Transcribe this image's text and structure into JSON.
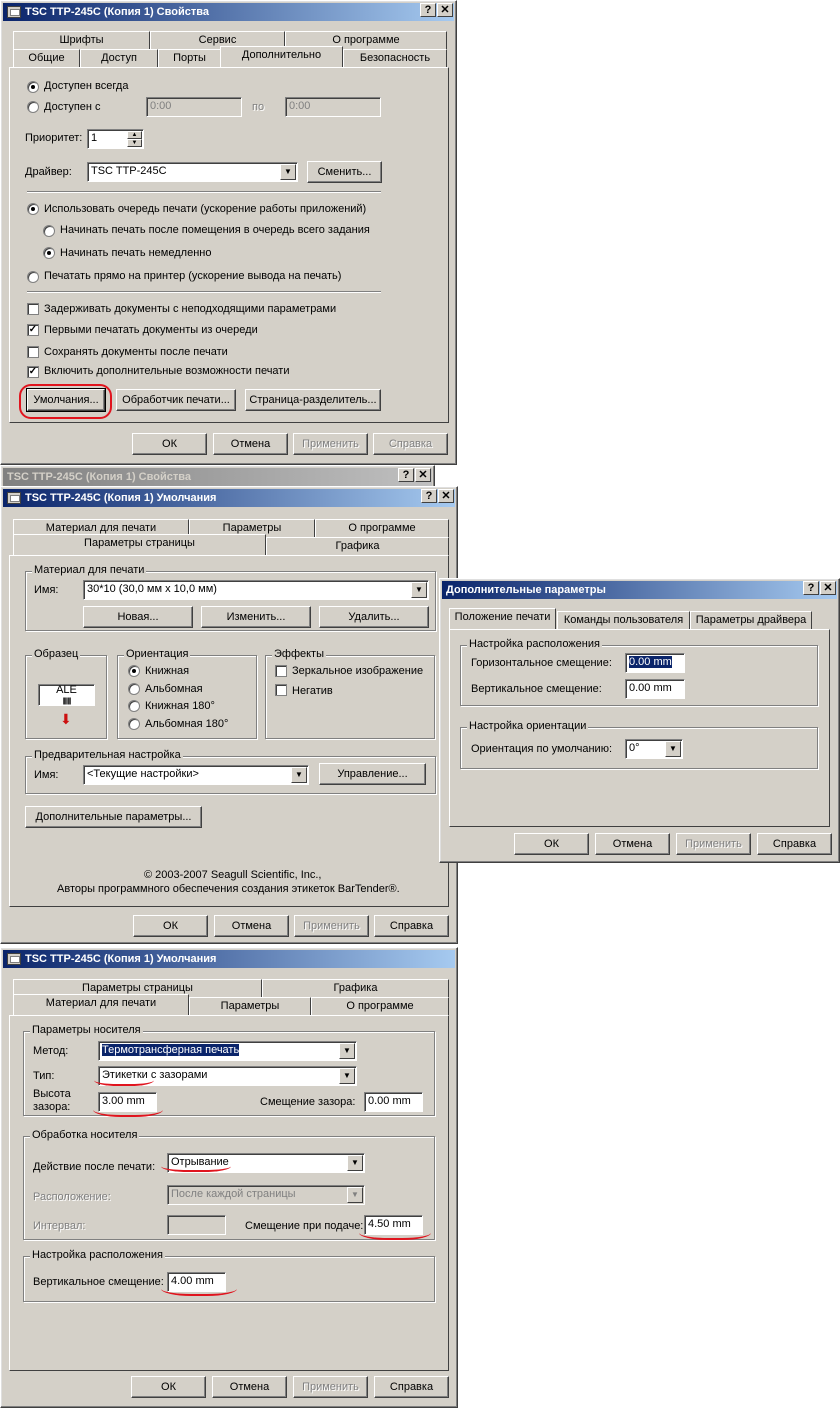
{
  "win1": {
    "title": "TSC TTP-245C (Копия 1) Свойства",
    "tabs_row1": [
      "Шрифты",
      "Сервис",
      "О программе"
    ],
    "tabs_row2": [
      "Общие",
      "Доступ",
      "Порты",
      "Дополнительно",
      "Безопасность"
    ],
    "always": "Доступен всегда",
    "from": "Доступен с",
    "time_from": "0:00",
    "to": "по",
    "time_to": "0:00",
    "priority_label": "Приоритет:",
    "priority_value": "1",
    "driver_label": "Драйвер:",
    "driver_value": "TSC TTP-245C",
    "change_btn": "Сменить...",
    "spool": "Использовать очередь печати (ускорение работы приложений)",
    "spool_after": "Начинать печать после помещения в очередь всего задания",
    "spool_immediate": "Начинать печать немедленно",
    "direct": "Печатать прямо на принтер (ускорение вывода на печать)",
    "chk_hold": "Задерживать документы с неподходящими параметрами",
    "chk_first": "Первыми печатать документы из очереди",
    "chk_keep": "Сохранять документы после печати",
    "chk_adv": "Включить дополнительные возможности печати",
    "defaults_btn": "Умолчания...",
    "processor_btn": "Обработчик печати...",
    "separator_btn": "Страница-разделитель...",
    "ok": "ОК",
    "cancel": "Отмена",
    "apply": "Применить",
    "help": "Справка"
  },
  "win2_bg_title": "TSC TTP-245C (Копия 1) Свойства",
  "win2": {
    "title": "TSC TTP-245C (Копия 1) Умолчания",
    "tabs_row1": [
      "Материал для печати",
      "Параметры",
      "О программе"
    ],
    "tabs_row2": [
      "Параметры страницы",
      "Графика"
    ],
    "media_group": "Материал для печати",
    "name_label": "Имя:",
    "name_value": "30*10 (30,0 мм x 10,0 мм)",
    "new_btn": "Новая...",
    "edit_btn": "Изменить...",
    "delete_btn": "Удалить...",
    "sample_group": "Образец",
    "sample_text": "ALE",
    "orient_group": "Ориентация",
    "portrait": "Книжная",
    "landscape": "Альбомная",
    "portrait180": "Книжная 180°",
    "landscape180": "Альбомная 180°",
    "effects_group": "Эффекты",
    "mirror": "Зеркальное изображение",
    "negative": "Негатив",
    "preset_group": "Предварительная настройка",
    "preset_name": "Имя:",
    "preset_value": "<Текущие настройки>",
    "manage_btn": "Управление...",
    "more_btn": "Дополнительные параметры...",
    "copyright": "© 2003-2007 Seagull Scientific, Inc.,",
    "authors": "Авторы программного обеспечения создания этикеток BarTender®.",
    "ok": "ОК",
    "cancel": "Отмена",
    "apply": "Применить",
    "help": "Справка"
  },
  "win3": {
    "title": "Дополнительные параметры",
    "tabs": [
      "Положение печати",
      "Команды пользователя",
      "Параметры драйвера"
    ],
    "pos_group": "Настройка расположения",
    "h_offset_label": "Горизонтальное смещение:",
    "h_offset": "0.00 mm",
    "v_offset_label": "Вертикальное смещение:",
    "v_offset": "0.00 mm",
    "orient_group": "Настройка ориентации",
    "orient_label": "Ориентация по умолчанию:",
    "orient_value": "0°",
    "ok": "ОК",
    "cancel": "Отмена",
    "apply": "Применить",
    "help": "Справка"
  },
  "win4": {
    "title": "TSC TTP-245C (Копия 1) Умолчания",
    "tabs_row1": [
      "Параметры страницы",
      "Графика"
    ],
    "tabs_row2": [
      "Материал для печати",
      "Параметры",
      "О программе"
    ],
    "media_group": "Параметры носителя",
    "method_label": "Метод:",
    "method_value": "Термотрансферная печать",
    "type_label": "Тип:",
    "type_value": "Этикетки с зазорами",
    "gap_label1": "Высота",
    "gap_label2": "зазора:",
    "gap_value": "3.00 mm",
    "gap_offset_label": "Смещение зазора:",
    "gap_offset_value": "0.00 mm",
    "handling_group": "Обработка носителя",
    "after_label": "Действие после печати:",
    "after_value": "Отрывание",
    "occur_label": "Расположение:",
    "occur_value": "После каждой страницы",
    "interval_label": "Интервал:",
    "feed_label": "Смещение при подаче:",
    "feed_value": "4.50 mm",
    "pos_group": "Настройка расположения",
    "v_label": "Вертикальное смещение:",
    "v_value": "4.00 mm",
    "ok": "ОК",
    "cancel": "Отмена",
    "apply": "Применить",
    "help": "Справка"
  },
  "title_buttons": {
    "help": "?",
    "close": "✕"
  }
}
